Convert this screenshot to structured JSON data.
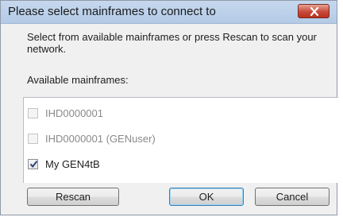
{
  "window": {
    "title": "Please select mainframes to connect to",
    "close_icon": "close-icon",
    "close_color": "#c8493a"
  },
  "instructions": "Select from available mainframes or press Rescan to scan your network.",
  "list": {
    "label": "Available mainframes:",
    "items": [
      {
        "label": "IHD0000001",
        "checked": false,
        "enabled": false
      },
      {
        "label": "IHD0000001 (GENuser)",
        "checked": false,
        "enabled": false
      },
      {
        "label": "My GEN4tB",
        "checked": true,
        "enabled": true
      }
    ]
  },
  "buttons": {
    "rescan": "Rescan",
    "ok": "OK",
    "cancel": "Cancel"
  }
}
